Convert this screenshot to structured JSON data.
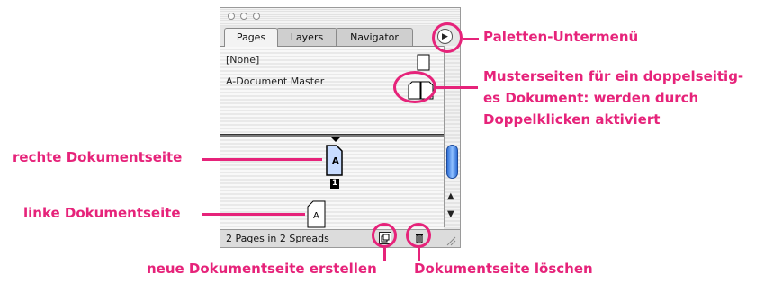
{
  "palette": {
    "tabs": [
      "Pages",
      "Layers",
      "Navigator"
    ],
    "masters": [
      {
        "label": "[None]"
      },
      {
        "label": "A-Document Master"
      }
    ],
    "page_number": "1",
    "page_master_letter_right": "A",
    "page_master_letter_left": "A",
    "status_text": "2 Pages in 2 Spreads",
    "menu_icon": "triangle-right-icon",
    "new_page_icon": "new-page-icon",
    "delete_icon": "trash-icon"
  },
  "annotations": {
    "palette_submenu": "Paletten-Untermenü",
    "masters_line1": "Musterseiten für ein doppelseitig-",
    "masters_line2": "es Dokument: werden durch",
    "masters_line3": "Doppelklicken aktiviert",
    "right_page": "rechte Dokumentseite",
    "left_page": "linke Dokumentseite",
    "new_page": "neue Dokumentseite erstellen",
    "delete_page": "Dokumentseite löschen"
  },
  "colors": {
    "annotation": "#e6237a",
    "scroll_thumb": "#2f6fd6",
    "page_selected": "#c8dcff"
  }
}
